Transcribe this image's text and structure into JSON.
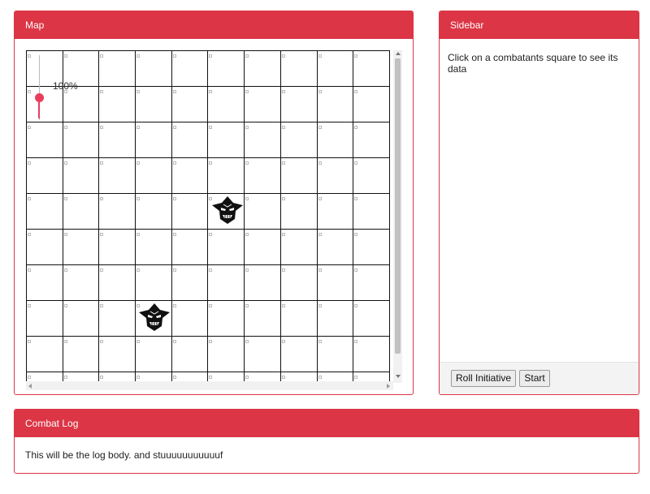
{
  "map_panel": {
    "title": "Map"
  },
  "zoom": {
    "label": "100%",
    "value": 100
  },
  "grid": {
    "rows": 10,
    "cols": 10
  },
  "tokens": [
    {
      "name": "goblin-token",
      "icon": "goblin-head-icon",
      "row": 4,
      "col": 5
    },
    {
      "name": "goblin-token",
      "icon": "goblin-head-icon",
      "row": 7,
      "col": 3
    }
  ],
  "sidebar": {
    "title": "Sidebar",
    "message": "Click on a combatants square to see its data",
    "buttons": {
      "roll_initiative": "Roll Initiative",
      "start": "Start"
    }
  },
  "combat_log": {
    "title": "Combat Log",
    "body": "This will be the log body. and stuuuuuuuuuuuf"
  },
  "colors": {
    "accent": "#dc3545",
    "slider": "#e83e5c"
  }
}
